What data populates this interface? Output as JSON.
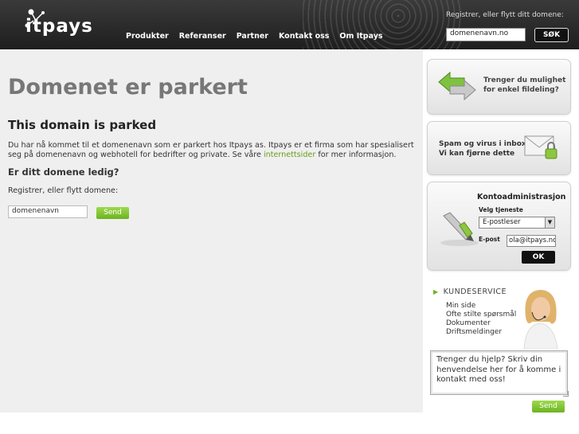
{
  "header": {
    "logo_text": "itpays",
    "nav": [
      "Produkter",
      "Referanser",
      "Partner",
      "Kontakt oss",
      "Om Itpays"
    ],
    "search_label": "Registrer, eller flytt ditt domene:",
    "search_value": "domenenavn.no",
    "search_button": "SØK"
  },
  "main": {
    "title": "Domenet er parkert",
    "subtitle": "This domain is parked",
    "description_pre": "Du har nå kommet til et domenenavn som er parkert hos Itpays as. Itpays er et firma som har spesialisert seg på domenenavn og webhotell for bedrifter og private. Se våre ",
    "description_link": "internettsider",
    "description_post": " for mer informasjon.",
    "question": "Er ditt domene ledig?",
    "register_label": "Registrer, eller flytt domene:",
    "domain_value": "domenenavn",
    "send_label": "Send"
  },
  "sidebar": {
    "file_share": "Trenger du mulighet\nfor enkel fildeling?",
    "spam": "Spam og virus i inboxen?\nVi kan fjørne dette",
    "account": {
      "title": "Kontoadministrasjon",
      "service_label": "Velg tjeneste",
      "service_value": "E-postleser",
      "email_label": "E-post",
      "email_value": "ola@itpays.no",
      "ok_label": "OK"
    },
    "customer_service": {
      "heading": "KUNDESERVICE",
      "links": [
        "Min side",
        "Ofte stilte spørsmål",
        "Dokumenter",
        "Driftsmeldinger"
      ],
      "help_text": "Trenger du hjelp? Skriv din henvendelse her for å komme i kontakt med oss!",
      "send_label": "Send"
    }
  },
  "colors": {
    "accent_green": "#6cb324",
    "header_dark": "#2a2a2a",
    "title_grey": "#777777"
  }
}
